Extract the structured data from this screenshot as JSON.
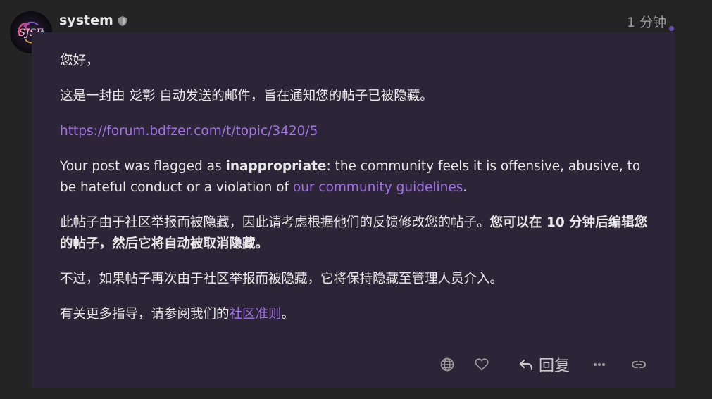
{
  "post": {
    "username": "system",
    "timestamp": "1 分钟",
    "reply_label": "回复"
  },
  "message": {
    "greeting": "您好，",
    "intro": "这是一封由 彣彰 自动发送的邮件，旨在通知您的帖子已被隐藏。",
    "topic_url": "https://forum.bdfzer.com/t/topic/3420/5",
    "flag_prefix": "Your post was flagged as ",
    "flag_bold": "inappropriate",
    "flag_middle": ": the community feels it is offensive, abusive, to be hateful conduct or a violation of ",
    "flag_link": "our community guidelines",
    "flag_suffix": ".",
    "hidden_text": "此帖子由于社区举报而被隐藏，因此请考虑根据他们的反馈修改您的帖子。",
    "hidden_bold": "您可以在 10 分钟后编辑您的帖子，然后它将自动被取消隐藏。",
    "warning": "不过，如果帖子再次由于社区举报而被隐藏，它将保持隐藏至管理人员介入。",
    "guide_prefix": "有关更多指导，请参阅我们的",
    "guide_link": "社区准则",
    "guide_suffix": "。"
  },
  "colors": {
    "page_bg": "#242424",
    "post_bg": "#2c2537",
    "link": "#a272e6",
    "muted": "#9a9a9a"
  },
  "icons": {
    "avatar": "avatar-logo",
    "moderator": "shield-icon",
    "translate": "globe-icon",
    "like": "heart-icon",
    "reply": "reply-arrow-icon",
    "more": "ellipsis-icon",
    "share": "link-icon"
  }
}
